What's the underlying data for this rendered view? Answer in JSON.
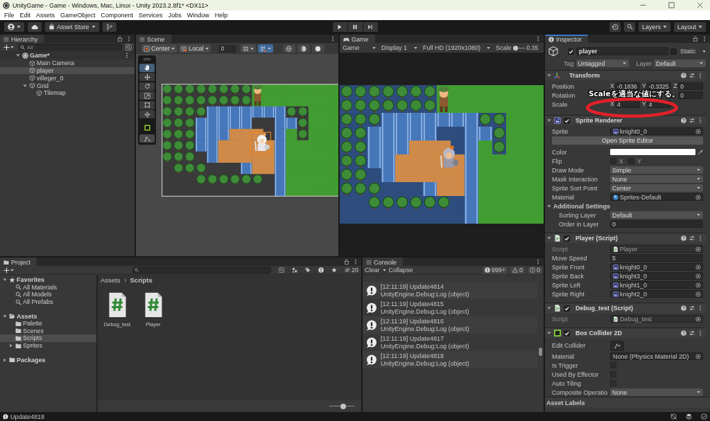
{
  "window": {
    "title": "UnityGame - Game - Windows, Mac, Linux - Unity 2023.2.8f1* <DX11>"
  },
  "menu": [
    "File",
    "Edit",
    "Assets",
    "GameObject",
    "Component",
    "Services",
    "Jobs",
    "Window",
    "Help"
  ],
  "toolbar": {
    "asset_store": "Asset Store",
    "layers": "Layers",
    "layout": "Layout"
  },
  "hierarchy": {
    "title": "Hierarchy",
    "focused": false,
    "search": {
      "placeholder": "All"
    },
    "tree": [
      {
        "label": "Game*",
        "kind": "scene",
        "expanded": true,
        "selected": false,
        "children": [
          {
            "label": "Main Camera",
            "kind": "object",
            "selected": false
          },
          {
            "label": "player",
            "kind": "object",
            "selected": true
          },
          {
            "label": "villeger_0",
            "kind": "object",
            "selected": false
          },
          {
            "label": "Grid",
            "kind": "object",
            "expanded": true,
            "selected": false,
            "children": [
              {
                "label": "Tilemap",
                "kind": "object",
                "selected": false
              }
            ]
          }
        ]
      }
    ]
  },
  "scene": {
    "title": "Scene",
    "focused": false,
    "pivot": "Center",
    "space": "Local",
    "snap_value": "0",
    "snap_selected": true,
    "tools": [
      {
        "kind": "hand",
        "selected": true
      },
      {
        "kind": "move",
        "selected": false
      },
      {
        "kind": "rotate",
        "selected": false
      },
      {
        "kind": "scale",
        "selected": false
      },
      {
        "kind": "rect",
        "selected": false
      },
      {
        "kind": "transform",
        "selected": false
      },
      {
        "kind": "tile",
        "selected": false
      },
      {
        "kind": "custom",
        "selected": false
      }
    ]
  },
  "game": {
    "title": "Game",
    "focused": false,
    "mode": "Game",
    "display": "Display 1",
    "resolution": "Full HD (1920x1080)",
    "scale_label": "Scale",
    "scale": {
      "level": 0,
      "reading": "0.35"
    }
  },
  "inspector": {
    "title": "Inspector",
    "focused": true,
    "object": {
      "name": "player",
      "active": true,
      "static": false,
      "static_label": "Static",
      "tag_label": "Tag",
      "tag": "Untagged",
      "layer_label": "Layer",
      "layer": "Default"
    },
    "components": [
      {
        "kind": "transform",
        "title": "Transform",
        "expanded": true,
        "rows": [
          {
            "kind": "vector",
            "label": "Position",
            "fields": {
              "x": {
                "axis": "X",
                "value": "-0.1836"
              },
              "y": {
                "axis": "Y",
                "value": "-0.3325"
              },
              "z": {
                "axis": "Z",
                "value": "0"
              }
            }
          },
          {
            "kind": "vector",
            "label": "Rotation",
            "fields": {
              "z": {
                "value": "0"
              }
            }
          },
          {
            "kind": "vector",
            "label": "Scale",
            "fields": {
              "x": {
                "axis": "X",
                "value": "4"
              },
              "y": {
                "axis": "Y",
                "value": "4"
              }
            }
          }
        ]
      },
      {
        "kind": "sprite_renderer",
        "title": "Sprite Renderer",
        "enabled": true,
        "expanded": true,
        "rows": [
          {
            "kind": "sprite_ref",
            "label": "Sprite",
            "value": "knight0_0"
          },
          {
            "kind": "button",
            "label": "Open Sprite Editor"
          },
          {
            "kind": "color",
            "label": "Color",
            "color": "#ffffff"
          },
          {
            "kind": "toggles",
            "label": "Flip",
            "options": [
              {
                "label": "X",
                "checked": false
              },
              {
                "label": "Y",
                "checked": false
              }
            ]
          },
          {
            "kind": "dropdown",
            "label": "Draw Mode",
            "value": "Simple"
          },
          {
            "kind": "dropdown",
            "label": "Mask Interaction",
            "value": "None"
          },
          {
            "kind": "dropdown",
            "label": "Sprite Sort Point",
            "value": "Center"
          },
          {
            "kind": "material_ref",
            "label": "Material",
            "value": "Sprites-Default"
          },
          {
            "kind": "foldout",
            "label": "Additional Settings",
            "expanded": true,
            "children": [
              {
                "kind": "dropdown",
                "label": "Sorting Layer",
                "value": "Default"
              },
              {
                "kind": "text",
                "label": "Order in Layer",
                "value": "0"
              }
            ]
          }
        ]
      },
      {
        "kind": "script",
        "title": "Player (Script)",
        "enabled": true,
        "expanded": true,
        "rows": [
          {
            "kind": "script_ref",
            "label": "Script",
            "value": "Player",
            "disabled": true
          },
          {
            "kind": "text",
            "label": "Move Speed",
            "value": "5",
            "disabled": false
          },
          {
            "kind": "sprite_ref",
            "label": "Sprite Front",
            "value": "knight0_0",
            "disabled": false
          },
          {
            "kind": "sprite_ref",
            "label": "Sprite Back",
            "value": "knight3_0",
            "disabled": false
          },
          {
            "kind": "sprite_ref",
            "label": "Sprite Left",
            "value": "knight1_0",
            "disabled": false
          },
          {
            "kind": "sprite_ref",
            "label": "Sprite Right",
            "value": "knight2_0",
            "disabled": false
          }
        ]
      },
      {
        "kind": "script",
        "title": "Debug_test (Script)",
        "enabled": true,
        "expanded": true,
        "rows": [
          {
            "kind": "script_ref",
            "label": "Script",
            "value": "Debug_test",
            "disabled": true
          }
        ]
      },
      {
        "kind": "collider",
        "title": "Box Collider 2D",
        "enabled": true,
        "expanded": true,
        "rows": [
          {
            "kind": "edit_collider",
            "label": "Edit Collider"
          },
          {
            "kind": "object",
            "label": "Material",
            "value": "None (Physics Material 2D)"
          },
          {
            "kind": "checkbox",
            "label": "Is Trigger",
            "checked": false
          },
          {
            "kind": "checkbox",
            "label": "Used By Effector",
            "checked": false
          },
          {
            "kind": "checkbox",
            "label": "Auto Tiling",
            "checked": false
          },
          {
            "kind": "dropdown",
            "label": "Composite Operatio",
            "value": "None"
          }
        ]
      }
    ],
    "asset_labels": "Asset Labels"
  },
  "project": {
    "title": "Project",
    "focused": false,
    "hidden_count": "20",
    "tree": [
      {
        "label": "Favorites",
        "kind": "favorites",
        "expanded": true,
        "selected": false,
        "children": [
          {
            "label": "All Materials",
            "kind": "search",
            "selected": false
          },
          {
            "label": "All Models",
            "kind": "search",
            "selected": false
          },
          {
            "label": "All Prefabs",
            "kind": "search",
            "selected": false
          }
        ]
      },
      {
        "label": "Assets",
        "kind": "folder",
        "expanded": true,
        "selected": false,
        "children": [
          {
            "label": "Palette",
            "kind": "folder",
            "selected": false
          },
          {
            "label": "Scenes",
            "kind": "folder",
            "selected": false
          },
          {
            "label": "Scripts",
            "kind": "folder",
            "selected": true
          },
          {
            "label": "Sprites",
            "kind": "folder",
            "expanded": false,
            "selected": false
          }
        ]
      },
      {
        "label": "Packages",
        "kind": "folder",
        "expanded": false,
        "selected": false
      }
    ],
    "breadcrumb": [
      "Assets",
      "Scripts"
    ],
    "files": [
      {
        "name": "Debug_test",
        "kind": "script",
        "selected": false
      },
      {
        "name": "Player",
        "kind": "script",
        "selected": false
      }
    ],
    "zoom": {
      "level": 0.57
    }
  },
  "console": {
    "title": "Console",
    "focused": false,
    "clear": "Clear",
    "collapse": "Collapse",
    "counts": [
      {
        "kind": "log",
        "value": "999+"
      },
      {
        "kind": "warning",
        "value": "0"
      },
      {
        "kind": "error",
        "value": "0"
      }
    ],
    "entries": [
      {
        "message": "[12:11:19] Update4814",
        "trace": "UnityEngine.Debug:Log (object)"
      },
      {
        "message": "[12:11:19] Update4815",
        "trace": "UnityEngine.Debug:Log (object)"
      },
      {
        "message": "[12:11:19] Update4816",
        "trace": "UnityEngine.Debug:Log (object)"
      },
      {
        "message": "[12:11:19] Update4817",
        "trace": "UnityEngine.Debug:Log (object)"
      },
      {
        "message": "[12:11:19] Update4818",
        "trace": "UnityEngine.Debug:Log (object)"
      }
    ]
  },
  "status_bar": {
    "message": "Update4818"
  },
  "annotation": {
    "text": "Scaleを適当な値にする。"
  }
}
